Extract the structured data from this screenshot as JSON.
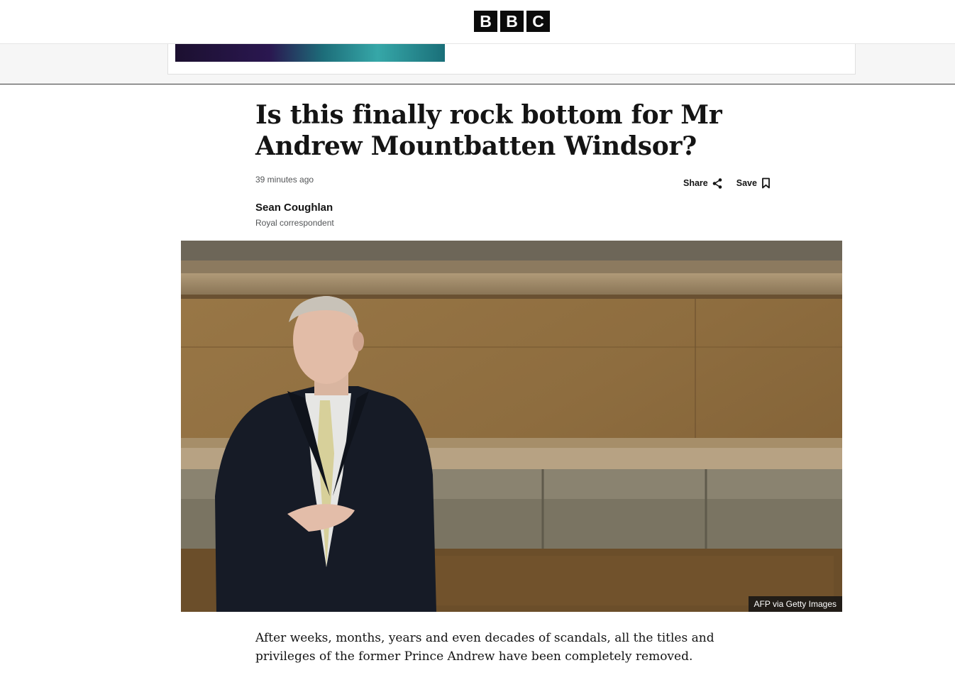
{
  "header": {
    "logo_letters": [
      "B",
      "B",
      "C"
    ]
  },
  "article": {
    "headline": "Is this finally rock bottom for Mr Andrew Mountbatten Windsor?",
    "timestamp": "39 minutes ago",
    "share_label": "Share",
    "save_label": "Save",
    "author_name": "Sean Coughlan",
    "author_role": "Royal correspondent",
    "image_credit": "AFP via Getty Images",
    "intro": "After weeks, months, years and even decades of scandals, all the titles and privileges of the former Prince Andrew have been completely removed."
  },
  "icons": {
    "share": "share-icon",
    "save": "bookmark-icon"
  },
  "colors": {
    "text": "#141414",
    "muted": "#545658",
    "logo_bg": "#0b0b0b"
  }
}
